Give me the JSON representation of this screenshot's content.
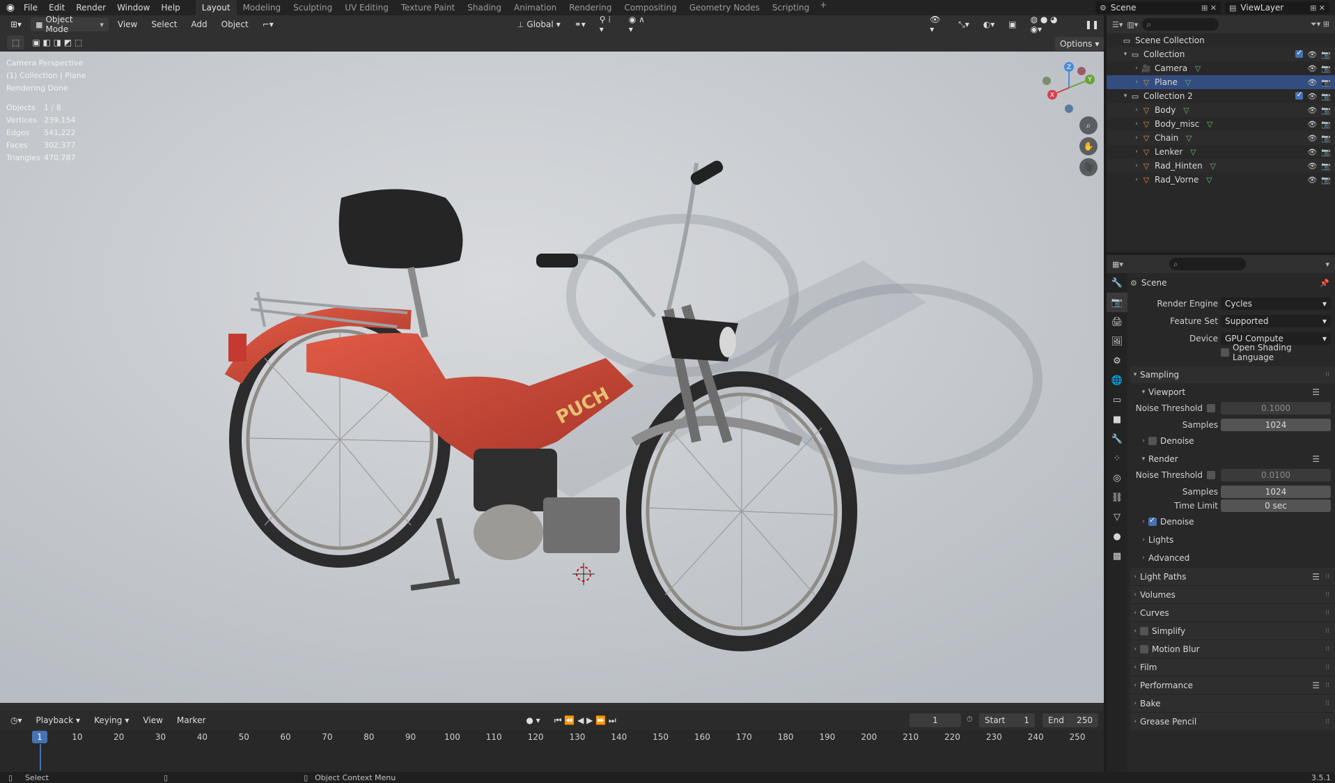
{
  "menu": {
    "items": [
      "File",
      "Edit",
      "Render",
      "Window",
      "Help"
    ]
  },
  "workspaces": [
    "Layout",
    "Modeling",
    "Sculpting",
    "UV Editing",
    "Texture Paint",
    "Shading",
    "Animation",
    "Rendering",
    "Compositing",
    "Geometry Nodes",
    "Scripting"
  ],
  "active_workspace": "Layout",
  "scene_name": "Scene",
  "view_layer": "ViewLayer",
  "viewport": {
    "mode": "Object Mode",
    "menus": [
      "View",
      "Select",
      "Add",
      "Object"
    ],
    "transform": "Global",
    "options_label": "Options",
    "overlay_lines": [
      "Camera Perspective",
      "(1) Collection | Plane",
      "Rendering Done"
    ],
    "stats": [
      {
        "k": "Objects",
        "v": "1 / 8"
      },
      {
        "k": "Vertices",
        "v": "239,154"
      },
      {
        "k": "Edges",
        "v": "541,222"
      },
      {
        "k": "Faces",
        "v": "302,377"
      },
      {
        "k": "Triangles",
        "v": "470,787"
      }
    ],
    "gizmo": {
      "x": "X",
      "y": "Y",
      "z": "Z"
    },
    "brand": "PUCH"
  },
  "timeline": {
    "menus": [
      "Playback",
      "Keying",
      "View",
      "Marker"
    ],
    "current_frame": "1",
    "start_label": "Start",
    "start": "1",
    "end_label": "End",
    "end": "250",
    "ticks": [
      "1",
      "10",
      "20",
      "30",
      "40",
      "50",
      "60",
      "70",
      "80",
      "90",
      "100",
      "110",
      "120",
      "130",
      "140",
      "150",
      "160",
      "170",
      "180",
      "190",
      "200",
      "210",
      "220",
      "230",
      "240",
      "250"
    ]
  },
  "status": {
    "left": "Select",
    "middle": "Object Context Menu",
    "version": "3.5.1"
  },
  "outliner": {
    "root": "Scene Collection",
    "rows": [
      {
        "name": "Collection",
        "level": 1,
        "type": "collection"
      },
      {
        "name": "Camera",
        "level": 2,
        "type": "camera"
      },
      {
        "name": "Plane",
        "level": 2,
        "type": "mesh",
        "selected": true
      },
      {
        "name": "Collection 2",
        "level": 1,
        "type": "collection"
      },
      {
        "name": "Body",
        "level": 2,
        "type": "mesh"
      },
      {
        "name": "Body_misc",
        "level": 2,
        "type": "mesh"
      },
      {
        "name": "Chain",
        "level": 2,
        "type": "mesh"
      },
      {
        "name": "Lenker",
        "level": 2,
        "type": "mesh"
      },
      {
        "name": "Rad_Hinten",
        "level": 2,
        "type": "mesh"
      },
      {
        "name": "Rad_Vorne",
        "level": 2,
        "type": "mesh"
      }
    ]
  },
  "properties": {
    "context": "Scene",
    "render_engine_label": "Render Engine",
    "render_engine": "Cycles",
    "feature_set_label": "Feature Set",
    "feature_set": "Supported",
    "device_label": "Device",
    "device": "GPU Compute",
    "osl_label": "Open Shading Language",
    "sampling": "Sampling",
    "viewport": "Viewport",
    "noise_threshold_label": "Noise Threshold",
    "vp_noise": "0.1000",
    "samples_label": "Samples",
    "vp_samples": "1024",
    "denoise_label": "Denoise",
    "render": "Render",
    "r_noise": "0.0100",
    "r_samples": "1024",
    "time_limit_label": "Time Limit",
    "time_limit": "0 sec",
    "lights": "Lights",
    "advanced": "Advanced",
    "sections": [
      "Light Paths",
      "Volumes",
      "Curves",
      "Simplify",
      "Motion Blur",
      "Film",
      "Performance",
      "Bake",
      "Grease Pencil"
    ]
  }
}
